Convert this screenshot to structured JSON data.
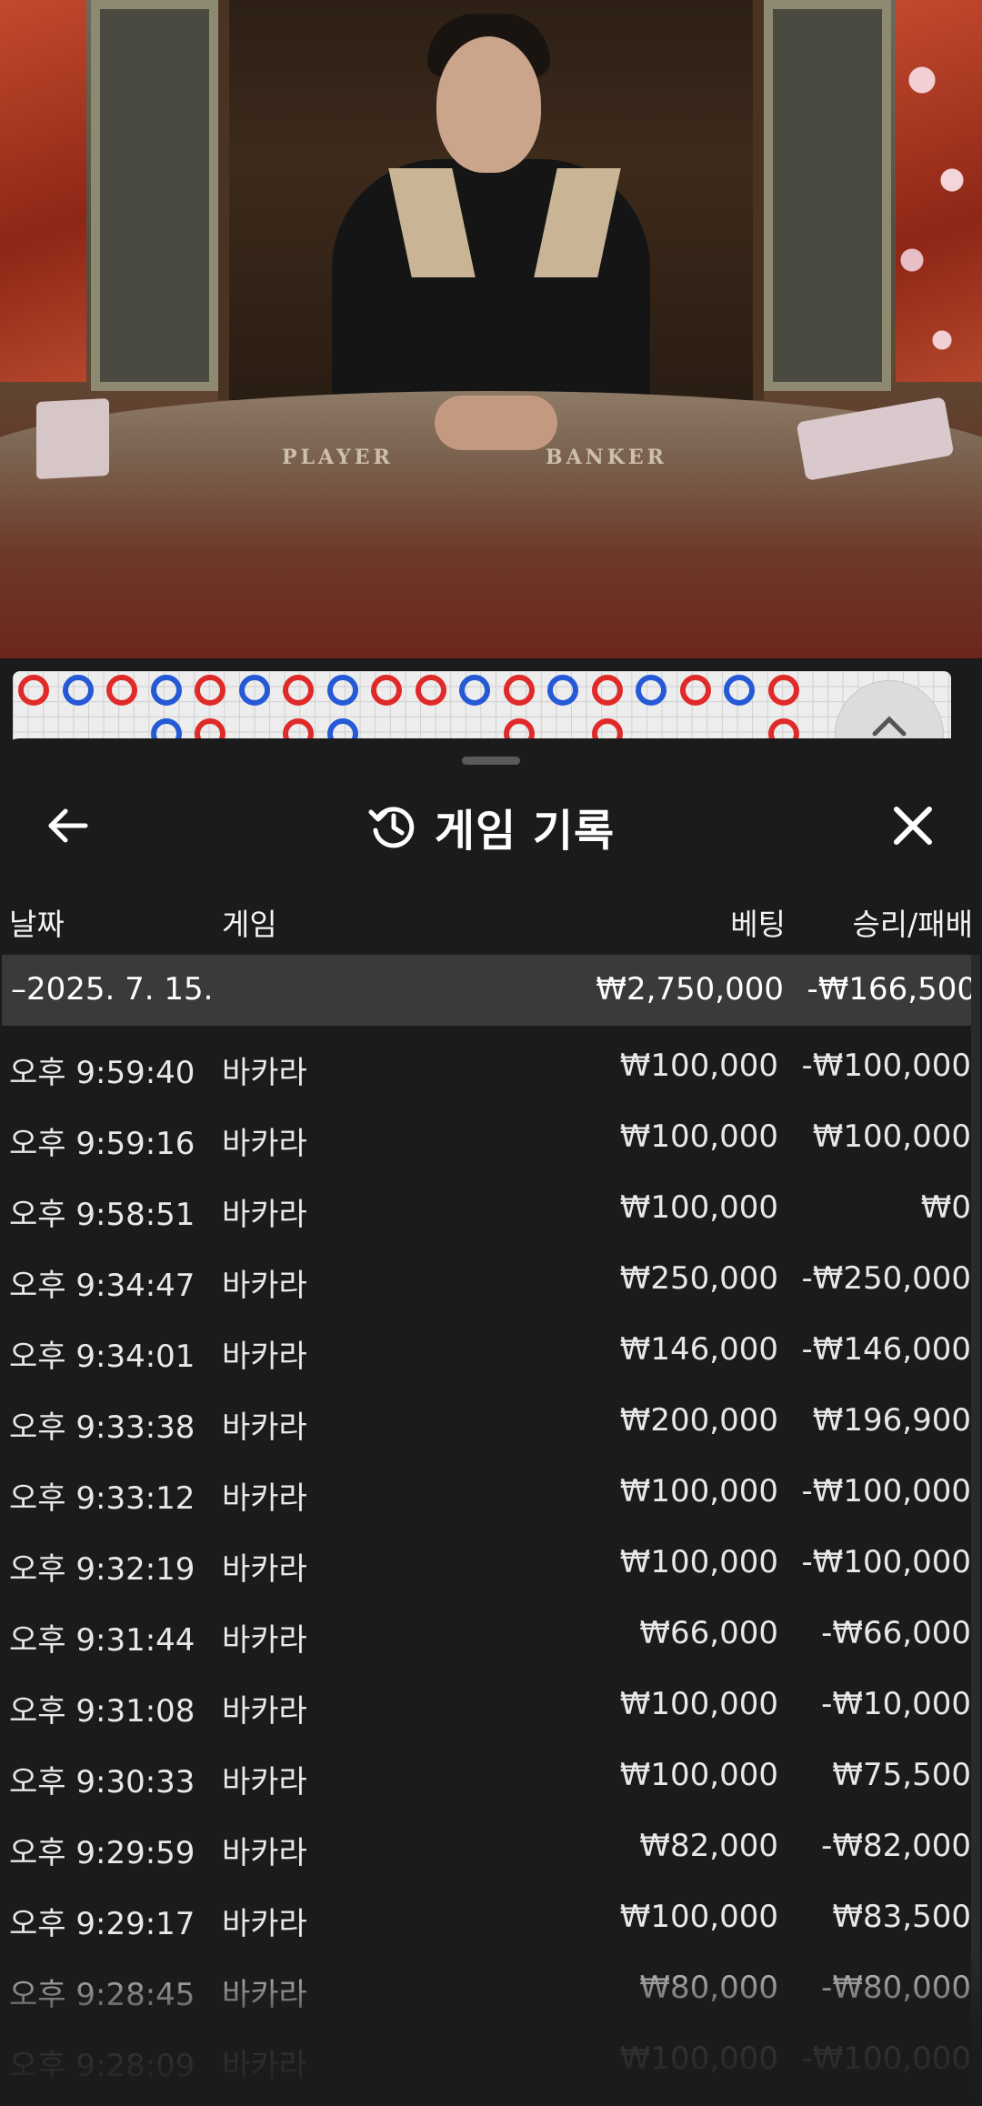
{
  "header": {
    "title": "게임 기록",
    "icons": {
      "back": "arrow-left-icon",
      "history": "history-icon",
      "close": "close-icon"
    }
  },
  "columns": {
    "date": "날짜",
    "game": "게임",
    "bet": "베팅",
    "result": "승리/패배"
  },
  "summary": {
    "date": "–2025. 7. 15.",
    "bet": "₩2,750,000",
    "result": "-₩166,500"
  },
  "records": [
    {
      "time": "오후 9:59:40",
      "game": "바카라",
      "bet": "₩100,000",
      "result": "-₩100,000"
    },
    {
      "time": "오후 9:59:16",
      "game": "바카라",
      "bet": "₩100,000",
      "result": "₩100,000"
    },
    {
      "time": "오후 9:58:51",
      "game": "바카라",
      "bet": "₩100,000",
      "result": "₩0"
    },
    {
      "time": "오후 9:34:47",
      "game": "바카라",
      "bet": "₩250,000",
      "result": "-₩250,000"
    },
    {
      "time": "오후 9:34:01",
      "game": "바카라",
      "bet": "₩146,000",
      "result": "-₩146,000"
    },
    {
      "time": "오후 9:33:38",
      "game": "바카라",
      "bet": "₩200,000",
      "result": "₩196,900"
    },
    {
      "time": "오후 9:33:12",
      "game": "바카라",
      "bet": "₩100,000",
      "result": "-₩100,000"
    },
    {
      "time": "오후 9:32:19",
      "game": "바카라",
      "bet": "₩100,000",
      "result": "-₩100,000"
    },
    {
      "time": "오후 9:31:44",
      "game": "바카라",
      "bet": "₩66,000",
      "result": "-₩66,000"
    },
    {
      "time": "오후 9:31:08",
      "game": "바카라",
      "bet": "₩100,000",
      "result": "-₩10,000"
    },
    {
      "time": "오후 9:30:33",
      "game": "바카라",
      "bet": "₩100,000",
      "result": "₩75,500"
    },
    {
      "time": "오후 9:29:59",
      "game": "바카라",
      "bet": "₩82,000",
      "result": "-₩82,000"
    },
    {
      "time": "오후 9:29:17",
      "game": "바카라",
      "bet": "₩100,000",
      "result": "₩83,500"
    },
    {
      "time": "오후 9:28:45",
      "game": "바카라",
      "bet": "₩80,000",
      "result": "-₩80,000"
    },
    {
      "time": "오후 9:28:09",
      "game": "바카라",
      "bet": "₩100,000",
      "result": "-₩100,000"
    }
  ],
  "scene": {
    "table_labels": {
      "player": "PLAYER",
      "banker": "BANKER"
    }
  },
  "roadmap": {
    "top_row": [
      "red",
      "blue",
      "red",
      "blue",
      "red",
      "blue",
      "red",
      "blue",
      "red",
      "red",
      "blue",
      "red",
      "blue",
      "red",
      "blue",
      "red",
      "blue",
      "red"
    ],
    "second_row_columns": [
      3,
      4,
      6,
      7,
      11,
      13,
      17
    ]
  },
  "colors": {
    "banker_red": "#e02a2a",
    "player_blue": "#2659d6",
    "sheet_bg": "#1b1b1b",
    "summary_bg": "#3a3a3a"
  }
}
